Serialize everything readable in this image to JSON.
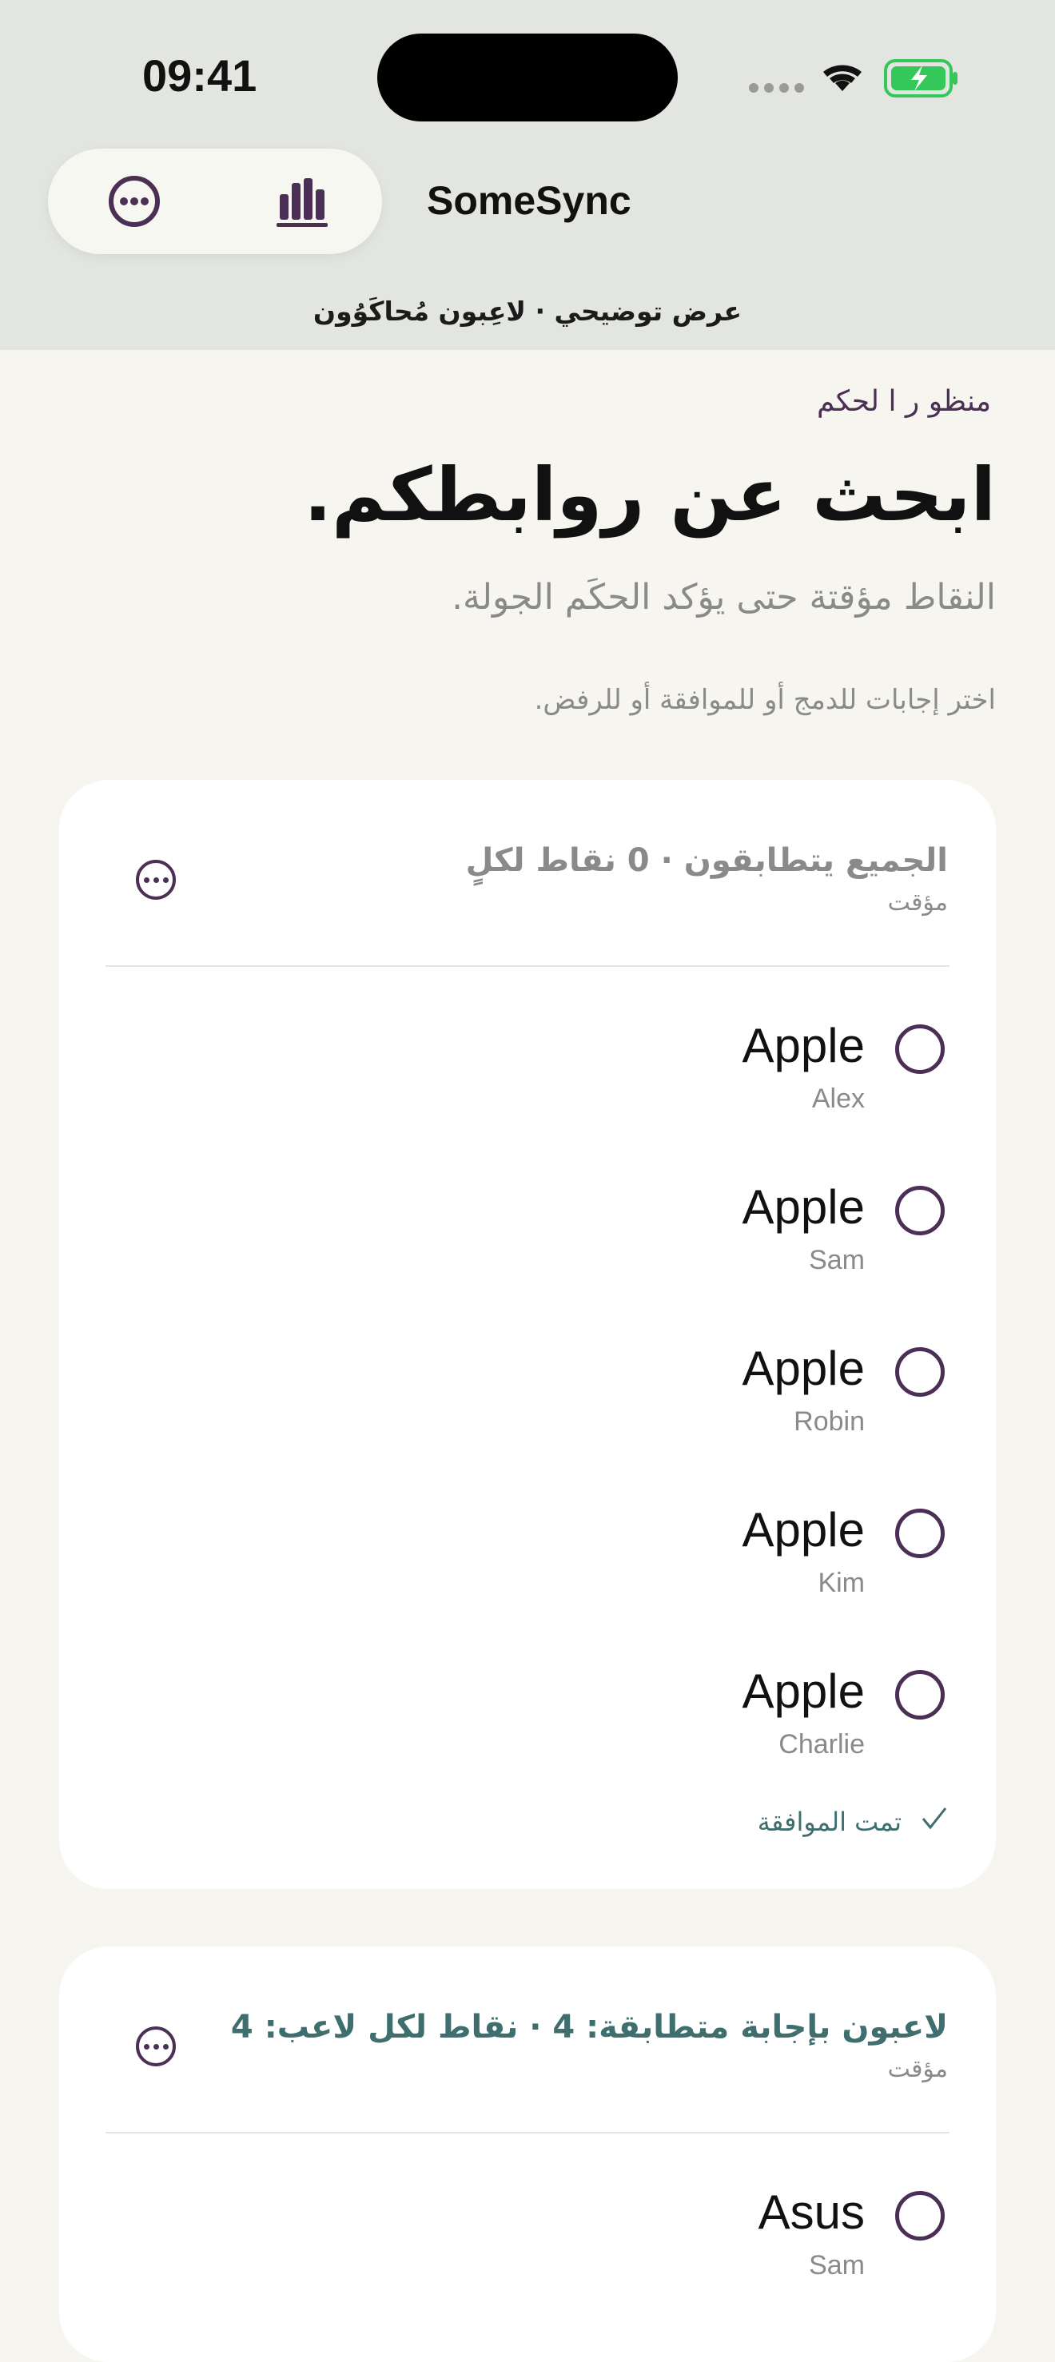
{
  "status_bar": {
    "time": "09:41"
  },
  "toolbar": {
    "more_icon": "ellipsis-circle-icon",
    "stats_icon": "bar-chart-icon",
    "app_title": "SomeSync"
  },
  "subtitle": "عرض توضيحي · لاعِبون مُحاكَوُون",
  "page": {
    "section_label": "منظو ر ا لحكم",
    "title": "ابحث عن روابطكم.",
    "lead": "النقاط مؤقتة حتى يؤكد الحكَم الجولة.",
    "instruction": "اختر إجابات للدمج أو للموافقة أو للرفض."
  },
  "groups": [
    {
      "title": "الجميع يتطابقون · 0 نقاط لكلٍ",
      "meta": "مؤقت",
      "answers": [
        {
          "text": "Apple",
          "player": "Alex"
        },
        {
          "text": "Apple",
          "player": "Sam"
        },
        {
          "text": "Apple",
          "player": "Robin"
        },
        {
          "text": "Apple",
          "player": "Kim"
        },
        {
          "text": "Apple",
          "player": "Charlie"
        }
      ],
      "status": "تمت الموافقة"
    },
    {
      "title": "لاعبون بإجابة متطابقة: 4 · نقاط لكل لاعب: 4",
      "meta": "مؤقت",
      "answers": [
        {
          "text": "Asus",
          "player": "Sam"
        }
      ]
    }
  ],
  "colors": {
    "accent": "#4b2f55",
    "header_bg": "#e2e5e0",
    "page_bg": "#f7f5ef",
    "teal": "#3e6e6e",
    "battery": "#34c759"
  }
}
